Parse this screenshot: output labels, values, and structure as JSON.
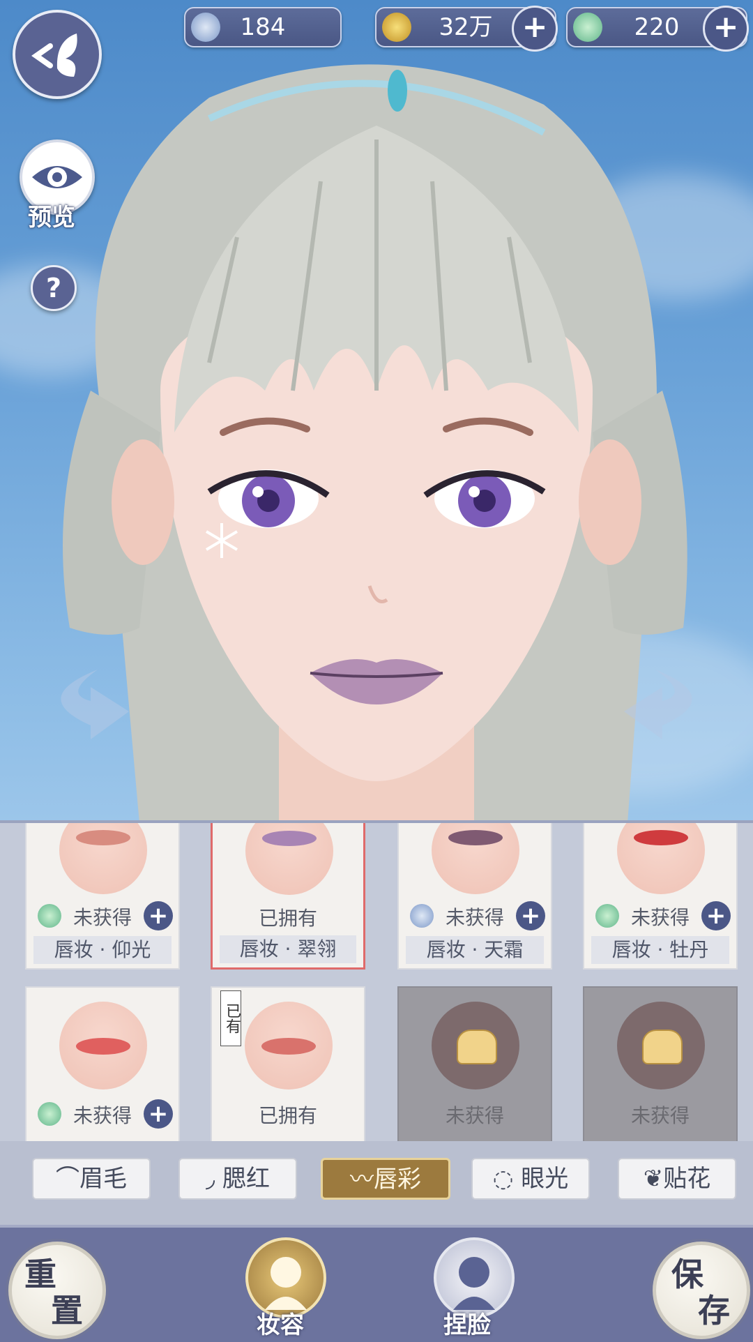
{
  "currency": [
    {
      "value": "184",
      "icon": "silver-coin-icon",
      "has_plus": false
    },
    {
      "value": "32万",
      "icon": "gold-coin-icon",
      "has_plus": true
    },
    {
      "value": "220",
      "icon": "jade-coin-icon",
      "has_plus": true
    }
  ],
  "left_buttons": {
    "preview_label": "预览",
    "help_label": "?"
  },
  "cards": [
    {
      "state": "未获得",
      "name": "唇妆 · 仰光",
      "currency_icon": "jade-coin-icon",
      "has_plus": true,
      "lip_color": "#d88c80",
      "selected": false,
      "locked": false
    },
    {
      "state": "已拥有",
      "name": "唇妆 · 翠翎",
      "currency_icon": "",
      "has_plus": false,
      "lip_color": "#a884b4",
      "selected": true,
      "locked": false
    },
    {
      "state": "未获得",
      "name": "唇妆 · 天霜",
      "currency_icon": "silver-coin-icon",
      "has_plus": true,
      "lip_color": "#7f5a72",
      "selected": false,
      "locked": false
    },
    {
      "state": "未获得",
      "name": "唇妆 · 牡丹",
      "currency_icon": "jade-coin-icon",
      "has_plus": true,
      "lip_color": "#cf3b3e",
      "selected": false,
      "locked": false
    },
    {
      "state": "未获得",
      "name": "",
      "currency_icon": "jade-coin-icon",
      "has_plus": true,
      "lip_color": "#e0605f",
      "selected": false,
      "locked": false
    },
    {
      "state": "已拥有",
      "name": "",
      "currency_icon": "",
      "has_plus": false,
      "lip_color": "#d9726c",
      "selected": false,
      "locked": false,
      "owned_tag": "已有"
    },
    {
      "state": "未获得",
      "name": "",
      "currency_icon": "",
      "has_plus": false,
      "lip_color": "#7d6a6c",
      "selected": false,
      "locked": true
    },
    {
      "state": "未获得",
      "name": "",
      "currency_icon": "",
      "has_plus": false,
      "lip_color": "#7d6a6c",
      "selected": false,
      "locked": true
    }
  ],
  "tabs": [
    {
      "label": "眉毛",
      "icon": "eyebrow-icon",
      "active": false
    },
    {
      "label": "腮红",
      "icon": "blush-icon",
      "active": false
    },
    {
      "label": "唇彩",
      "icon": "lips-icon",
      "active": true
    },
    {
      "label": "眼光",
      "icon": "eye-light-icon",
      "active": false
    },
    {
      "label": "贴花",
      "icon": "leaf-decal-icon",
      "active": false
    }
  ],
  "bottom": {
    "reset_label_top": "重",
    "reset_label_bottom": "置",
    "save_label_top": "保",
    "save_label_bottom": "存",
    "makeup_label": "妆容",
    "face_label": "捏脸"
  },
  "colors": {
    "panel": "#c4cad9",
    "accent_gold": "#9c7a3e",
    "selected_border": "#df6a6a",
    "bottom_bar": "#6c739e"
  }
}
